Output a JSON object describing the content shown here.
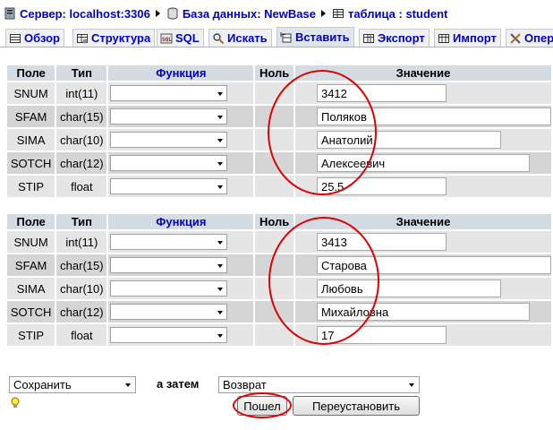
{
  "breadcrumb": {
    "server": "Сервер: localhost:3306",
    "database": "База данных: NewBase",
    "table": "таблица : student"
  },
  "tabs": [
    {
      "label": "Обзор",
      "icon": "browse-icon"
    },
    {
      "label": "Структура",
      "icon": "structure-icon"
    },
    {
      "label": "SQL",
      "icon": "sql-icon"
    },
    {
      "label": "Искать",
      "icon": "search-icon"
    },
    {
      "label": "Вставить",
      "icon": "insert-icon",
      "active": true
    },
    {
      "label": "Экспорт",
      "icon": "export-icon"
    },
    {
      "label": "Импорт",
      "icon": "import-icon"
    },
    {
      "label": "Опера",
      "icon": "operations-icon"
    }
  ],
  "columns": {
    "field": "Поле",
    "type": "Тип",
    "function": "Функция",
    "null": "Ноль",
    "value": "Значение"
  },
  "records": [
    {
      "rows": [
        {
          "field": "SNUM",
          "type": "int(11)",
          "value": "3412"
        },
        {
          "field": "SFAM",
          "type": "char(15)",
          "value": "Поляков"
        },
        {
          "field": "SIMA",
          "type": "char(10)",
          "value": "Анатолий"
        },
        {
          "field": "SOTCH",
          "type": "char(12)",
          "value": "Алексеевич"
        },
        {
          "field": "STIP",
          "type": "float",
          "value": "25.5"
        }
      ]
    },
    {
      "rows": [
        {
          "field": "SNUM",
          "type": "int(11)",
          "value": "3413"
        },
        {
          "field": "SFAM",
          "type": "char(15)",
          "value": "Старова"
        },
        {
          "field": "SIMA",
          "type": "char(10)",
          "value": "Любовь"
        },
        {
          "field": "SOTCH",
          "type": "char(12)",
          "value": "Михайловна"
        },
        {
          "field": "STIP",
          "type": "float",
          "value": "17"
        }
      ]
    }
  ],
  "footer": {
    "action_select": "Сохранить",
    "then_label": "а затем",
    "after_select": "Возврат",
    "go_button": "Пошел",
    "reset_button": "Переустановить"
  },
  "colors": {
    "link": "#0000cc",
    "header_bg": "#d3dce3",
    "highlight": "#e00000"
  }
}
